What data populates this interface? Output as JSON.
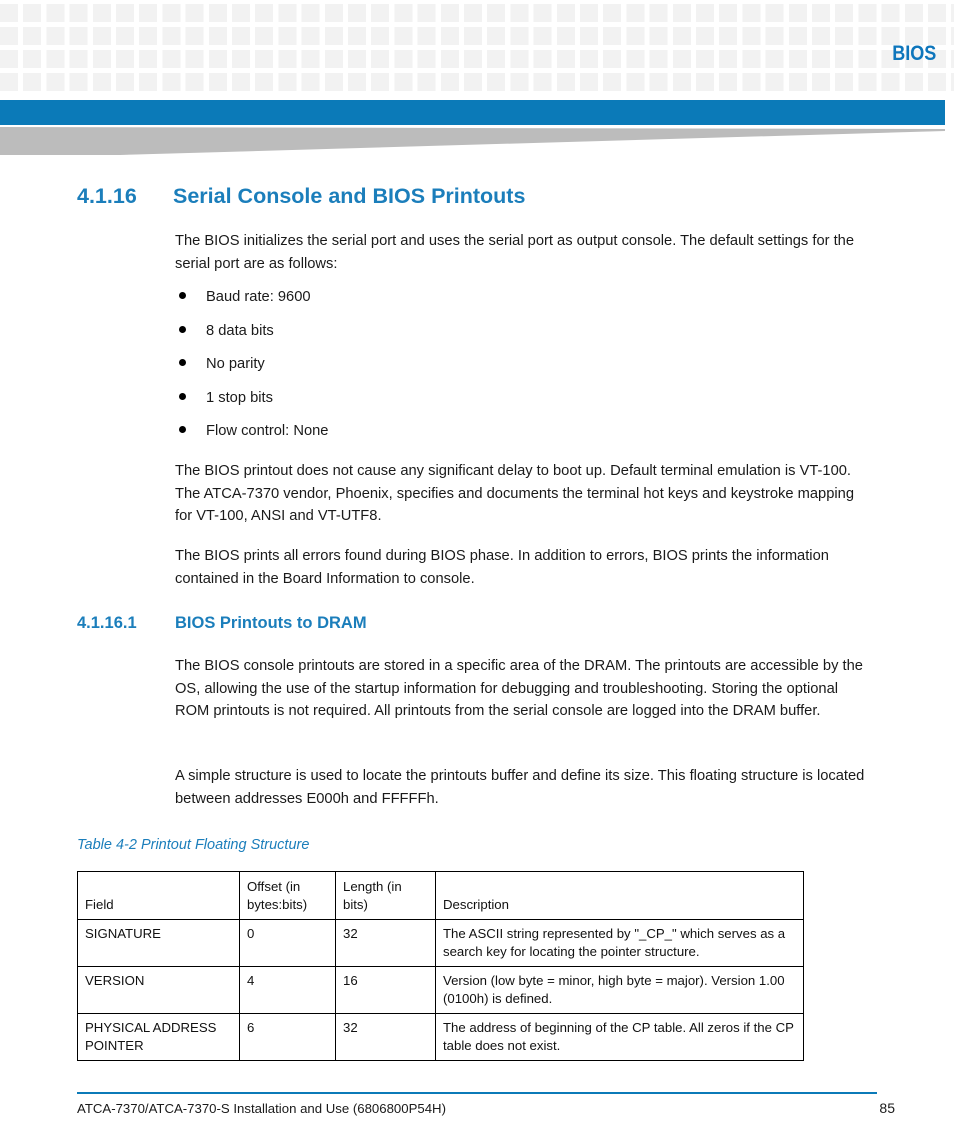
{
  "header": {
    "label": "BIOS",
    "accent_color": "#0b7ab8",
    "grid_square_color": "#f2f2f2",
    "swoosh_color": "#bcbcbc"
  },
  "heading": {
    "number": "4.1.16",
    "title": "Serial Console and BIOS Printouts"
  },
  "intro_paragraph": "The BIOS initializes the serial port and uses the serial port as output console. The default settings for the serial port are as follows:",
  "bullets": [
    {
      "text": "Baud rate: 9600"
    },
    {
      "text": "8 data bits"
    },
    {
      "text": "No parity"
    },
    {
      "text": "1 stop bits"
    },
    {
      "text": "Flow control: None"
    }
  ],
  "paragraph_2": "The BIOS printout does not cause any significant delay to boot up. Default terminal emulation is VT-100. The ATCA-7370 vendor, Phoenix, specifies and documents the terminal hot keys and keystroke mapping for VT-100, ANSI and VT-UTF8.",
  "paragraph_3": "The BIOS prints all errors found during BIOS phase. In addition to errors, BIOS prints the information contained in the Board Information to console.",
  "subheading": {
    "number": "4.1.16.1",
    "title": "BIOS Printouts to DRAM"
  },
  "paragraph_4": "The BIOS console printouts are stored in a specific area of the DRAM. The printouts are accessible by the OS, allowing the use of the startup information for debugging and troubleshooting. Storing the optional ROM printouts is not required. All printouts from the serial console are logged into the DRAM buffer.",
  "paragraph_5": "A simple structure is used to locate the printouts buffer and define its size. This floating structure is located between addresses E000h and FFFFFh.",
  "table": {
    "caption": "Table 4-2 Printout Floating Structure",
    "headers": {
      "field": "Field",
      "offset": "Offset (in bytes:bits)",
      "length": "Length (in bits)",
      "description": "Description"
    },
    "rows": [
      {
        "field": "SIGNATURE",
        "offset": "0",
        "length": "32",
        "description": "The ASCII string represented by \"_CP_\" which serves as a search key for locating the pointer structure."
      },
      {
        "field": "VERSION",
        "offset": "4",
        "length": "16",
        "description": "Version (low byte = minor, high byte = major). Version 1.00 (0100h) is defined."
      },
      {
        "field": "PHYSICAL ADDRESS POINTER",
        "offset": "6",
        "length": "32",
        "description": "The address of beginning of the CP table. All zeros if the CP table does not exist."
      }
    ]
  },
  "footer": {
    "document_title": "ATCA-7370/ATCA-7370-S Installation and Use (6806800P54H)",
    "page_number": "85"
  }
}
